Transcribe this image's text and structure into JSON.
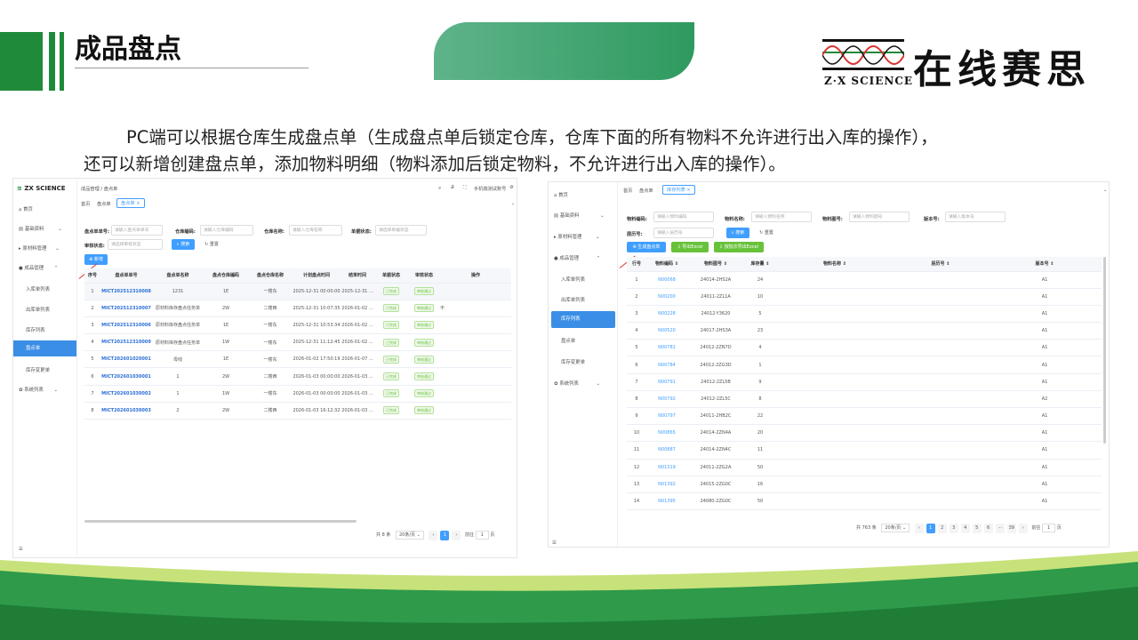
{
  "slide": {
    "title": "成品盘点",
    "logo_cn": "在线赛思",
    "logo_en": "Z·X SCIENCE",
    "description_lines": [
      "PC端可以根据仓库生成盘点单（生成盘点单后锁定仓库，仓库下面的所有物料不允许进行出入库的操作），",
      "还可以新增创建盘点单，添加物料明细（物料添加后锁定物料，不允许进行出入库的操作）。"
    ],
    "colors": {
      "brand_green": "#1f8a3a",
      "accent_blue": "#409eff",
      "success_green": "#67c23a"
    }
  },
  "shotA": {
    "brand": "ZX SCIENCE",
    "breadcrumb": "成品管理 / 盘点单",
    "user": "手机端测试账号",
    "tabs": [
      "首页",
      "盘点单",
      "盘点单 ×"
    ],
    "menu": [
      "首页",
      "基础资料",
      "原材料管理",
      "成品管理",
      "入库单列表",
      "出库单列表",
      "库存列表",
      "盘点单",
      "库存变更单",
      "系统列表"
    ],
    "filters": {
      "label_no": "盘点单单号:",
      "ph_no": "请输入盘点单单号",
      "label_wh_code": "仓库编码:",
      "ph_wh_code": "请输入仓库编码",
      "label_wh_name": "仓库名称:",
      "ph_wh_name": "请输入仓库名称",
      "label_status": "单据状态:",
      "ph_status": "请选择单据状态",
      "label_audit": "审核状态:",
      "ph_audit": "请选择审核状态",
      "search": "搜索",
      "reset": "重置"
    },
    "add_button": "新增",
    "columns": [
      "序号",
      "盘点单单号",
      "盘点单名称",
      "盘点仓库编码",
      "盘点仓库名称",
      "计划盘点时间",
      "结束时间",
      "单据状态",
      "审核状态",
      "操作"
    ],
    "rows": [
      [
        "1",
        "MICT202512310008",
        "1231",
        "1E",
        "一楼东",
        "2025-12-31 00:00:00",
        "2025-12-31 ...",
        "已完成",
        "审核通过"
      ],
      [
        "2",
        "MICT202512310007",
        "原材料库存盘点任务单",
        "2W",
        "二楼西",
        "2025-12-31 10:07:35",
        "2026-01-02 ...",
        "已完成",
        "审核通过"
      ],
      [
        "3",
        "MICT202512310006",
        "原材料库存盘点任务单",
        "1E",
        "一楼东",
        "2025-12-31 10:53:34",
        "2026-01-02 ...",
        "已完成",
        "审核通过"
      ],
      [
        "4",
        "MICT202512310009",
        "原材料库存盘点任务单",
        "1W",
        "一楼东",
        "2025-12-31 11:12:45",
        "2026-01-02 ...",
        "已完成",
        "审核通过"
      ],
      [
        "5",
        "MICT202601020001",
        "母线",
        "1E",
        "一楼东",
        "2026-01-02 17:50:19",
        "2026-01-07 ...",
        "已完成",
        "审核通过"
      ],
      [
        "6",
        "MICT202601030001",
        "1",
        "2W",
        "二楼西",
        "2026-01-03 00:00:00",
        "2026-01-03 ...",
        "已完成",
        "审核通过"
      ],
      [
        "7",
        "MICT202601030002",
        "1",
        "1W",
        "一楼东",
        "2026-01-03 00:00:00",
        "2026-01-03 ...",
        "已完成",
        "审核通过"
      ],
      [
        "8",
        "MICT202601030003",
        "2",
        "2W",
        "二楼西",
        "2026-01-03 16:12:32",
        "2026-01-03 ...",
        "已完成",
        "审核通过"
      ]
    ],
    "row2_action": "不",
    "pager": {
      "total": "共 8 条",
      "size": "20条/页",
      "page": "1",
      "goto": "前往",
      "goto_val": "1",
      "unit": "页"
    }
  },
  "shotB": {
    "tabs": [
      "首页",
      "盘点单",
      "库存列表 ×"
    ],
    "menu": [
      "首页",
      "基础资料",
      "原材料管理",
      "成品管理",
      "入库单列表",
      "出库单列表",
      "库存列表",
      "盘点单",
      "库存变更单",
      "系统列表"
    ],
    "filters": {
      "label_code": "物料编码:",
      "ph_code": "请输入物料编码",
      "label_name": "物料名称:",
      "ph_name": "请输入物料名称",
      "label_drawing": "物料图号:",
      "ph_drawing": "请输入物料图号",
      "label_version": "版本号:",
      "ph_version": "请输入版本号",
      "label_batch": "层历号:",
      "ph_batch": "请输入层历号",
      "search": "搜索",
      "reset": "重置"
    },
    "buttons": [
      "生成盘点单",
      "导出Excel",
      "按批次导出Excel"
    ],
    "columns": [
      "行号",
      "物料编码",
      "物料图号",
      "库存量",
      "物料名称",
      "层历号",
      "版本号"
    ],
    "rows": [
      [
        "1",
        "N00068",
        "24014-2HS2A",
        "24",
        "",
        "",
        "A1"
      ],
      [
        "2",
        "N00200",
        "24011-2ZL1A",
        "10",
        "",
        "",
        "A1"
      ],
      [
        "3",
        "N00228",
        "24012-Y3620",
        "5",
        "",
        "",
        "A1"
      ],
      [
        "4",
        "N00520",
        "24017-2HS3A",
        "23",
        "",
        "",
        "A1"
      ],
      [
        "5",
        "N00781",
        "24012-2ZN7D",
        "4",
        "",
        "",
        "A1"
      ],
      [
        "6",
        "N00784",
        "24012-2ZG3D",
        "1",
        "",
        "",
        "A1"
      ],
      [
        "7",
        "N00791",
        "24012-2ZL5B",
        "9",
        "",
        "",
        "A1"
      ],
      [
        "8",
        "N00792",
        "24012-2ZL5C",
        "8",
        "",
        "",
        "A2"
      ],
      [
        "9",
        "N00797",
        "24011-2HB2C",
        "22",
        "",
        "",
        "A1"
      ],
      [
        "10",
        "N00865",
        "24014-2ZN4A",
        "20",
        "",
        "",
        "A1"
      ],
      [
        "11",
        "N00887",
        "24014-2ZN4C",
        "11",
        "",
        "",
        "A1"
      ],
      [
        "12",
        "N01319",
        "24011-2ZG2A",
        "50",
        "",
        "",
        "A1"
      ],
      [
        "13",
        "N01392",
        "24015-2ZG0C",
        "16",
        "",
        "",
        "A1"
      ],
      [
        "14",
        "N01395",
        "24080-2ZG0C",
        "50",
        "",
        "",
        "A1"
      ]
    ],
    "pager": {
      "total": "共 763 条",
      "size": "20条/页",
      "pages": [
        "1",
        "2",
        "3",
        "4",
        "5",
        "6",
        "···",
        "39"
      ],
      "goto": "前往",
      "goto_val": "1",
      "unit": "页"
    }
  }
}
